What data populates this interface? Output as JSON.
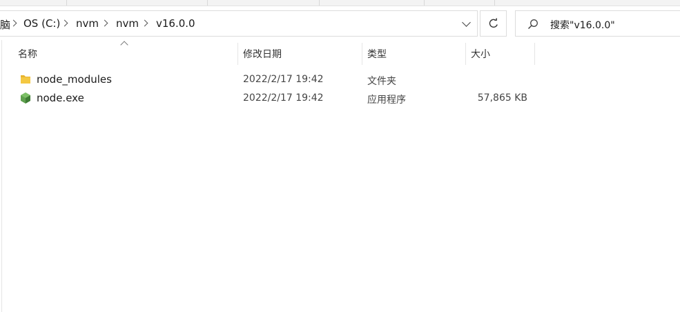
{
  "breadcrumb": {
    "partial_first": "脑",
    "segments": [
      "OS (C:)",
      "nvm",
      "nvm",
      "v16.0.0"
    ]
  },
  "search": {
    "placeholder": "搜索\"v16.0.0\""
  },
  "columns": {
    "name": "名称",
    "modified": "修改日期",
    "type": "类型",
    "size": "大小"
  },
  "files": [
    {
      "name": "node_modules",
      "modified": "2022/2/17 19:42",
      "type": "文件夹",
      "size": "",
      "icon": "folder-icon"
    },
    {
      "name": "node.exe",
      "modified": "2022/2/17 19:42",
      "type": "应用程序",
      "size": "57,865 KB",
      "icon": "nodejs-icon"
    }
  ],
  "colors": {
    "folder": "#f4c842",
    "node_green": "#5fa04e"
  }
}
